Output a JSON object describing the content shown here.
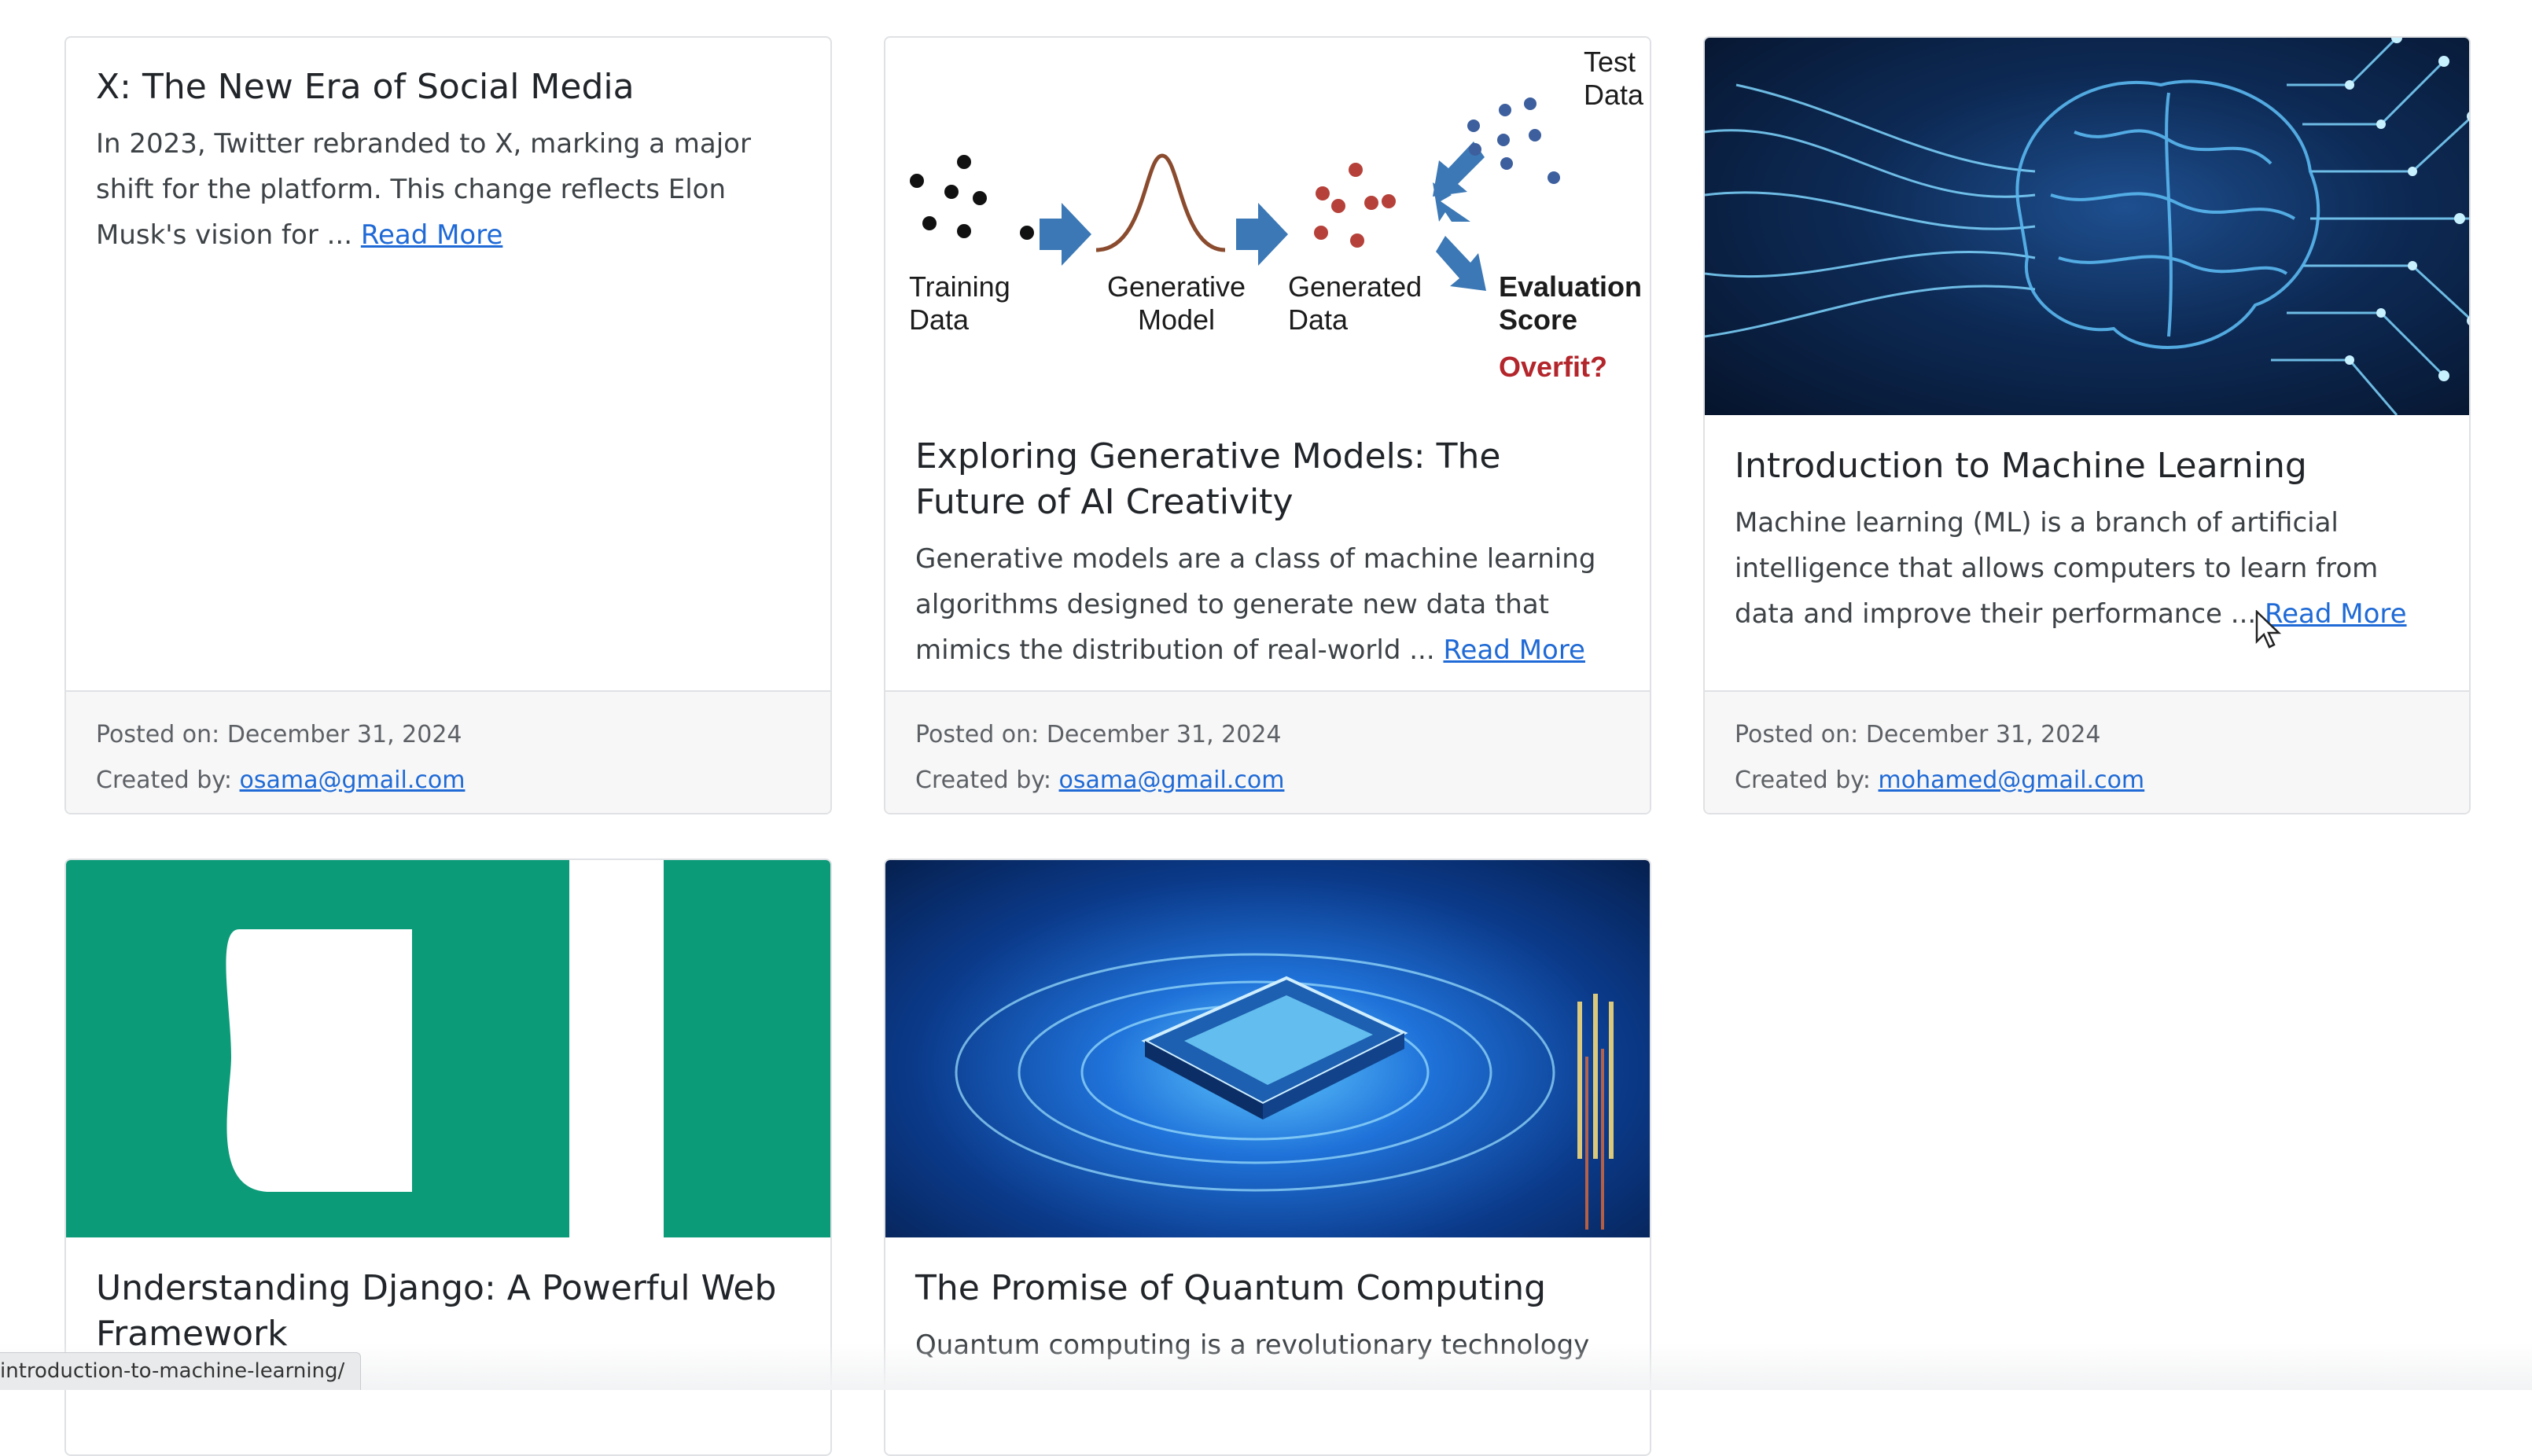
{
  "cards": [
    {
      "title": "X: The New Era of Social Media",
      "excerpt": "In 2023, Twitter rebranded to X, marking a major shift for the platform. This change reflects Elon Musk's vision for ... ",
      "read_more": "Read More",
      "posted_on": "Posted on: December 31, 2024",
      "created_by_label": "Created by: ",
      "author": "osama@gmail.com"
    },
    {
      "title": "Exploring Generative Models: The Future of AI Creativity",
      "excerpt": "Generative models are a class of machine learning algorithms designed to generate new data that mimics the distribution of real-world ... ",
      "read_more": "Read More",
      "posted_on": "Posted on: December 31, 2024",
      "created_by_label": "Created by: ",
      "author": "osama@gmail.com",
      "image": {
        "training": "Training\nData",
        "model": "Generative\nModel",
        "generated": "Generated\nData",
        "test": "Test\nData",
        "evaluation": "Evaluation\nScore",
        "overfit": "Overfit?"
      }
    },
    {
      "title": "Introduction to Machine Learning",
      "excerpt": "Machine learning (ML) is a branch of artificial intelligence that allows computers to learn from data and improve their performance ... ",
      "read_more": "Read More",
      "posted_on": "Posted on: December 31, 2024",
      "created_by_label": "Created by: ",
      "author": "mohamed@gmail.com"
    },
    {
      "title": "Understanding Django: A Powerful Web Framework",
      "excerpt": "",
      "read_more": ""
    },
    {
      "title": "The Promise of Quantum Computing",
      "excerpt": "Quantum computing is a revolutionary technology"
    }
  ],
  "status_bar": {
    "url": "introduction-to-machine-learning/"
  },
  "colors": {
    "link": "#1f6ad6",
    "django_green": "#0c9b78",
    "ml_bg": "#0a1e3f",
    "quantum_bg": "#0b3a8a"
  }
}
